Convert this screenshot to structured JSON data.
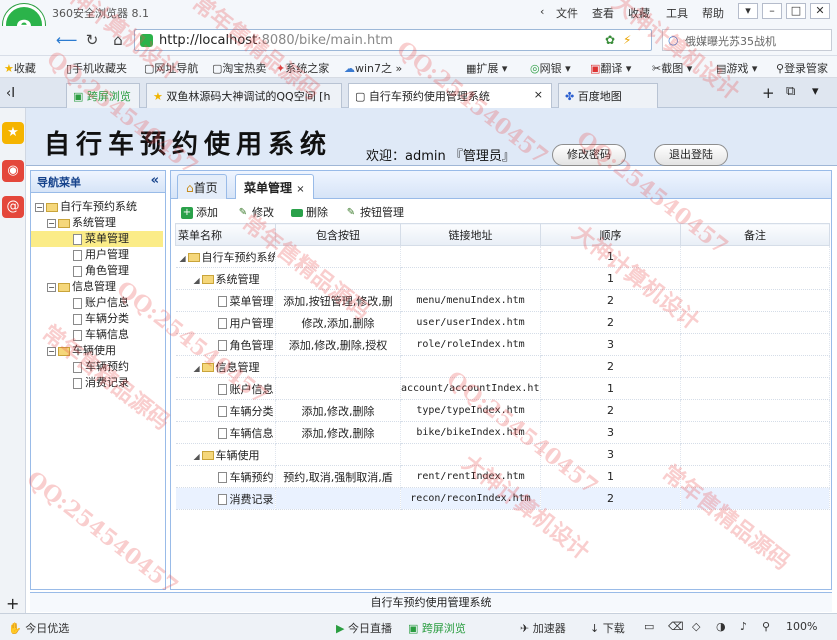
{
  "browser": {
    "title": "360安全浏览器 8.1",
    "menu": [
      "文件",
      "查看",
      "收藏",
      "工具",
      "帮助"
    ],
    "url_host": "http://localhost",
    "url_path": ":8080/bike/main.htm",
    "search_text": "俄媒曝光苏35战机",
    "bookmarks": [
      "收藏",
      "手机收藏夹",
      "网址导航",
      "淘宝热卖",
      "系统之家",
      "win7之",
      "扩展",
      "网银",
      "翻译",
      "截图",
      "游戏",
      "登录管家"
    ],
    "tabs": [
      "跨屏浏览",
      "双鱼林源码大神调试的QQ空间 [h",
      "自行车预约使用管理系统",
      "百度地图"
    ],
    "status_left": "今日优选",
    "status_items": [
      "今日直播",
      "跨屏浏览",
      "加速器",
      "下载"
    ],
    "zoom": "100%"
  },
  "header": {
    "title": "自行车预约使用系统",
    "welcome": "欢迎：admin 『管理员』",
    "change_pwd": "修改密码",
    "logout": "退出登陆"
  },
  "nav": {
    "title": "导航菜单",
    "collapse": "«",
    "root": "自行车预约系统",
    "groups": [
      {
        "label": "系统管理",
        "items": [
          "菜单管理",
          "用户管理",
          "角色管理"
        ]
      },
      {
        "label": "信息管理",
        "items": [
          "账户信息",
          "车辆分类",
          "车辆信息"
        ]
      },
      {
        "label": "车辆使用",
        "items": [
          "车辆预约",
          "消费记录"
        ]
      }
    ]
  },
  "tabs": {
    "home": "首页",
    "menu": "菜单管理",
    "close": "×"
  },
  "toolbar": {
    "add": "添加",
    "edit": "修改",
    "delete": "删除",
    "button_mgmt": "按钮管理"
  },
  "grid": {
    "headers": [
      "菜单名称",
      "包含按钮",
      "链接地址",
      "顺序",
      "备注"
    ],
    "rows": [
      {
        "name": "自行车预约系统",
        "buttons": "",
        "url": "",
        "order": "1",
        "note": ""
      },
      {
        "name": "系统管理",
        "buttons": "",
        "url": "",
        "order": "1",
        "note": ""
      },
      {
        "name": "菜单管理",
        "buttons": "添加,按钮管理,修改,删",
        "url": "menu/menuIndex.htm",
        "order": "2",
        "note": ""
      },
      {
        "name": "用户管理",
        "buttons": "修改,添加,删除",
        "url": "user/userIndex.htm",
        "order": "2",
        "note": ""
      },
      {
        "name": "角色管理",
        "buttons": "添加,修改,删除,授权",
        "url": "role/roleIndex.htm",
        "order": "3",
        "note": ""
      },
      {
        "name": "信息管理",
        "buttons": "",
        "url": "",
        "order": "2",
        "note": ""
      },
      {
        "name": "账户信息",
        "buttons": "",
        "url": "account/accountIndex.htm",
        "order": "1",
        "note": ""
      },
      {
        "name": "车辆分类",
        "buttons": "添加,修改,删除",
        "url": "type/typeIndex.htm",
        "order": "2",
        "note": ""
      },
      {
        "name": "车辆信息",
        "buttons": "添加,修改,删除",
        "url": "bike/bikeIndex.htm",
        "order": "3",
        "note": ""
      },
      {
        "name": "车辆使用",
        "buttons": "",
        "url": "",
        "order": "3",
        "note": ""
      },
      {
        "name": "车辆预约",
        "buttons": "预约,取消,强制取消,盾",
        "url": "rent/rentIndex.htm",
        "order": "1",
        "note": ""
      },
      {
        "name": "消费记录",
        "buttons": "",
        "url": "recon/reconIndex.htm",
        "order": "2",
        "note": ""
      }
    ]
  },
  "footer": "自行车预约使用管理系统",
  "watermarks": [
    "QQ:254540457",
    "常年售精品源码",
    "大神计算机设计"
  ]
}
